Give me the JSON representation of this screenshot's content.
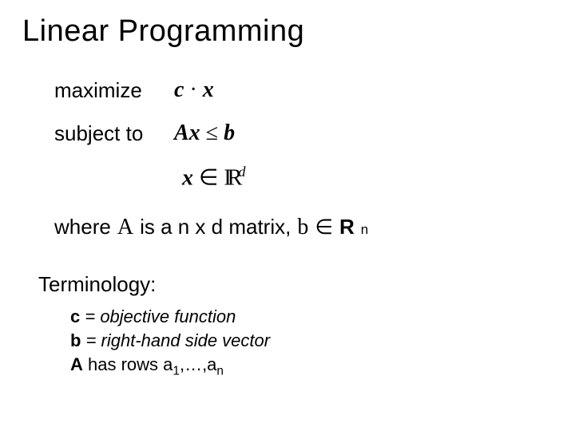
{
  "title": "Linear Programming",
  "rows": {
    "maximize_label": "maximize",
    "maximize_expr_c": "c",
    "maximize_expr_dot": " · ",
    "maximize_expr_x": "x",
    "subject_label": "subject to",
    "Ax": "Ax",
    "leq": " ≤ ",
    "b": "b",
    "x2": "x",
    "in": " ∈ ",
    "Rsym": "IR",
    "d": "d"
  },
  "where": {
    "where_label": "where",
    "A": "A",
    "is_matrix": " is a n x d matrix, ",
    "b": "b",
    "in": "∈",
    "R": "R",
    "n": "n"
  },
  "terminology": {
    "heading": "Terminology:",
    "c_sym": "c",
    "c_def": " = objective function",
    "b_sym": "b",
    "b_def": " = right-hand side vector",
    "A_sym": "A",
    "A_has": " has rows a",
    "sub1": "1",
    "dots": ",…,a",
    "subn": "n"
  }
}
